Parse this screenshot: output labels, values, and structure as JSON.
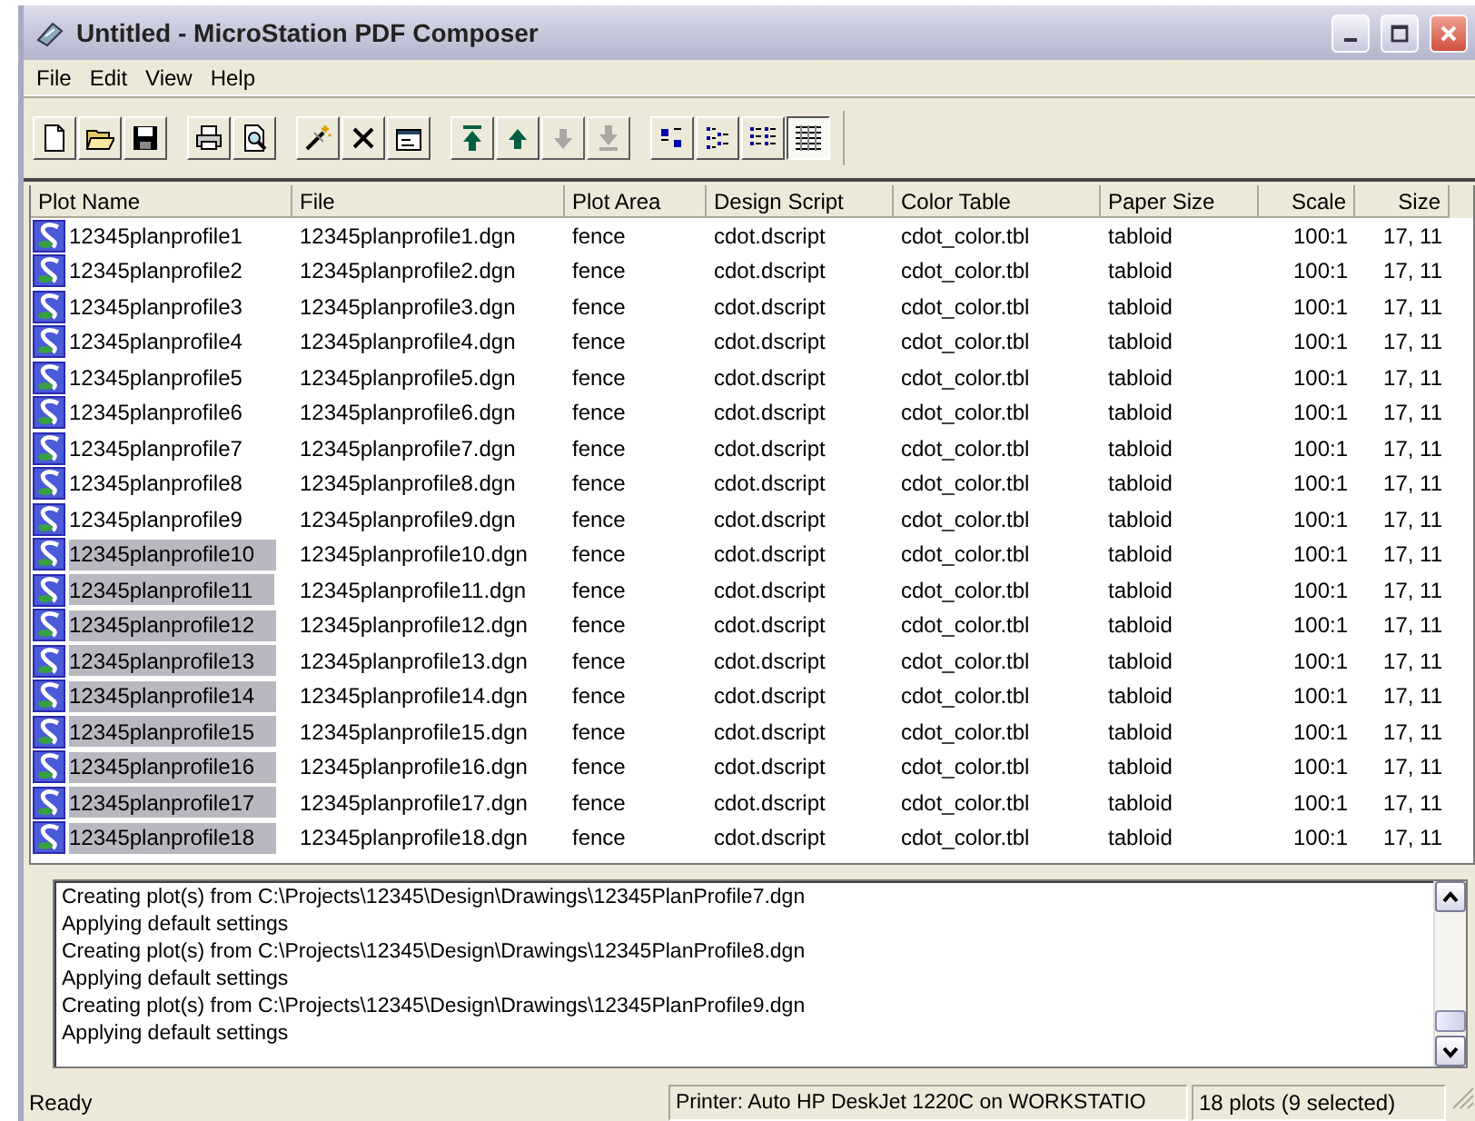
{
  "window": {
    "title": "Untitled - MicroStation PDF Composer"
  },
  "menu": [
    "File",
    "Edit",
    "View",
    "Help"
  ],
  "toolbar": [
    {
      "kind": "new",
      "disabled": false,
      "selected": false
    },
    {
      "kind": "open",
      "disabled": false,
      "selected": false
    },
    {
      "kind": "save",
      "disabled": false,
      "selected": false
    },
    {
      "kind": "gap"
    },
    {
      "kind": "print",
      "disabled": false,
      "selected": false
    },
    {
      "kind": "preview",
      "disabled": false,
      "selected": false
    },
    {
      "kind": "gap"
    },
    {
      "kind": "wand",
      "disabled": false,
      "selected": false
    },
    {
      "kind": "delete",
      "disabled": false,
      "selected": false
    },
    {
      "kind": "properties",
      "disabled": false,
      "selected": false
    },
    {
      "kind": "gap"
    },
    {
      "kind": "top",
      "disabled": false,
      "selected": false
    },
    {
      "kind": "up",
      "disabled": false,
      "selected": false
    },
    {
      "kind": "down",
      "disabled": true,
      "selected": false
    },
    {
      "kind": "bottom",
      "disabled": true,
      "selected": false
    },
    {
      "kind": "gap"
    },
    {
      "kind": "large-icons",
      "disabled": false,
      "selected": false
    },
    {
      "kind": "small-icons",
      "disabled": false,
      "selected": false
    },
    {
      "kind": "list",
      "disabled": false,
      "selected": false
    },
    {
      "kind": "details",
      "disabled": false,
      "selected": true
    }
  ],
  "table": {
    "columns": [
      "Plot Name",
      "File",
      "Plot Area",
      "Design Script",
      "Color Table",
      "Paper Size",
      "Scale",
      "Size"
    ],
    "rows": [
      {
        "cells": [
          "12345planprofile1",
          "12345planprofile1.dgn",
          "fence",
          "cdot.dscript",
          "cdot_color.tbl",
          "tabloid",
          "100:1",
          "17, 11"
        ],
        "selected": false
      },
      {
        "cells": [
          "12345planprofile2",
          "12345planprofile2.dgn",
          "fence",
          "cdot.dscript",
          "cdot_color.tbl",
          "tabloid",
          "100:1",
          "17, 11"
        ],
        "selected": false
      },
      {
        "cells": [
          "12345planprofile3",
          "12345planprofile3.dgn",
          "fence",
          "cdot.dscript",
          "cdot_color.tbl",
          "tabloid",
          "100:1",
          "17, 11"
        ],
        "selected": false
      },
      {
        "cells": [
          "12345planprofile4",
          "12345planprofile4.dgn",
          "fence",
          "cdot.dscript",
          "cdot_color.tbl",
          "tabloid",
          "100:1",
          "17, 11"
        ],
        "selected": false
      },
      {
        "cells": [
          "12345planprofile5",
          "12345planprofile5.dgn",
          "fence",
          "cdot.dscript",
          "cdot_color.tbl",
          "tabloid",
          "100:1",
          "17, 11"
        ],
        "selected": false
      },
      {
        "cells": [
          "12345planprofile6",
          "12345planprofile6.dgn",
          "fence",
          "cdot.dscript",
          "cdot_color.tbl",
          "tabloid",
          "100:1",
          "17, 11"
        ],
        "selected": false
      },
      {
        "cells": [
          "12345planprofile7",
          "12345planprofile7.dgn",
          "fence",
          "cdot.dscript",
          "cdot_color.tbl",
          "tabloid",
          "100:1",
          "17, 11"
        ],
        "selected": false
      },
      {
        "cells": [
          "12345planprofile8",
          "12345planprofile8.dgn",
          "fence",
          "cdot.dscript",
          "cdot_color.tbl",
          "tabloid",
          "100:1",
          "17, 11"
        ],
        "selected": false
      },
      {
        "cells": [
          "12345planprofile9",
          "12345planprofile9.dgn",
          "fence",
          "cdot.dscript",
          "cdot_color.tbl",
          "tabloid",
          "100:1",
          "17, 11"
        ],
        "selected": false
      },
      {
        "cells": [
          "12345planprofile10",
          "12345planprofile10.dgn",
          "fence",
          "cdot.dscript",
          "cdot_color.tbl",
          "tabloid",
          "100:1",
          "17, 11"
        ],
        "selected": true
      },
      {
        "cells": [
          "12345planprofile11",
          "12345planprofile11.dgn",
          "fence",
          "cdot.dscript",
          "cdot_color.tbl",
          "tabloid",
          "100:1",
          "17, 11"
        ],
        "selected": true
      },
      {
        "cells": [
          "12345planprofile12",
          "12345planprofile12.dgn",
          "fence",
          "cdot.dscript",
          "cdot_color.tbl",
          "tabloid",
          "100:1",
          "17, 11"
        ],
        "selected": true
      },
      {
        "cells": [
          "12345planprofile13",
          "12345planprofile13.dgn",
          "fence",
          "cdot.dscript",
          "cdot_color.tbl",
          "tabloid",
          "100:1",
          "17, 11"
        ],
        "selected": true
      },
      {
        "cells": [
          "12345planprofile14",
          "12345planprofile14.dgn",
          "fence",
          "cdot.dscript",
          "cdot_color.tbl",
          "tabloid",
          "100:1",
          "17, 11"
        ],
        "selected": true
      },
      {
        "cells": [
          "12345planprofile15",
          "12345planprofile15.dgn",
          "fence",
          "cdot.dscript",
          "cdot_color.tbl",
          "tabloid",
          "100:1",
          "17, 11"
        ],
        "selected": true
      },
      {
        "cells": [
          "12345planprofile16",
          "12345planprofile16.dgn",
          "fence",
          "cdot.dscript",
          "cdot_color.tbl",
          "tabloid",
          "100:1",
          "17, 11"
        ],
        "selected": true
      },
      {
        "cells": [
          "12345planprofile17",
          "12345planprofile17.dgn",
          "fence",
          "cdot.dscript",
          "cdot_color.tbl",
          "tabloid",
          "100:1",
          "17, 11"
        ],
        "selected": true
      },
      {
        "cells": [
          "12345planprofile18",
          "12345planprofile18.dgn",
          "fence",
          "cdot.dscript",
          "cdot_color.tbl",
          "tabloid",
          "100:1",
          "17, 11"
        ],
        "selected": true
      }
    ]
  },
  "log": [
    "Creating plot(s) from C:\\Projects\\12345\\Design\\Drawings\\12345PlanProfile7.dgn",
    "Applying default settings",
    "Creating plot(s) from C:\\Projects\\12345\\Design\\Drawings\\12345PlanProfile8.dgn",
    "Applying default settings",
    "Creating plot(s) from C:\\Projects\\12345\\Design\\Drawings\\12345PlanProfile9.dgn",
    "Applying default settings"
  ],
  "status_bar": [
    "Ready",
    "Printer: Auto HP DeskJet 1220C on WORKSTATIO",
    "18 plots (9 selected)"
  ]
}
